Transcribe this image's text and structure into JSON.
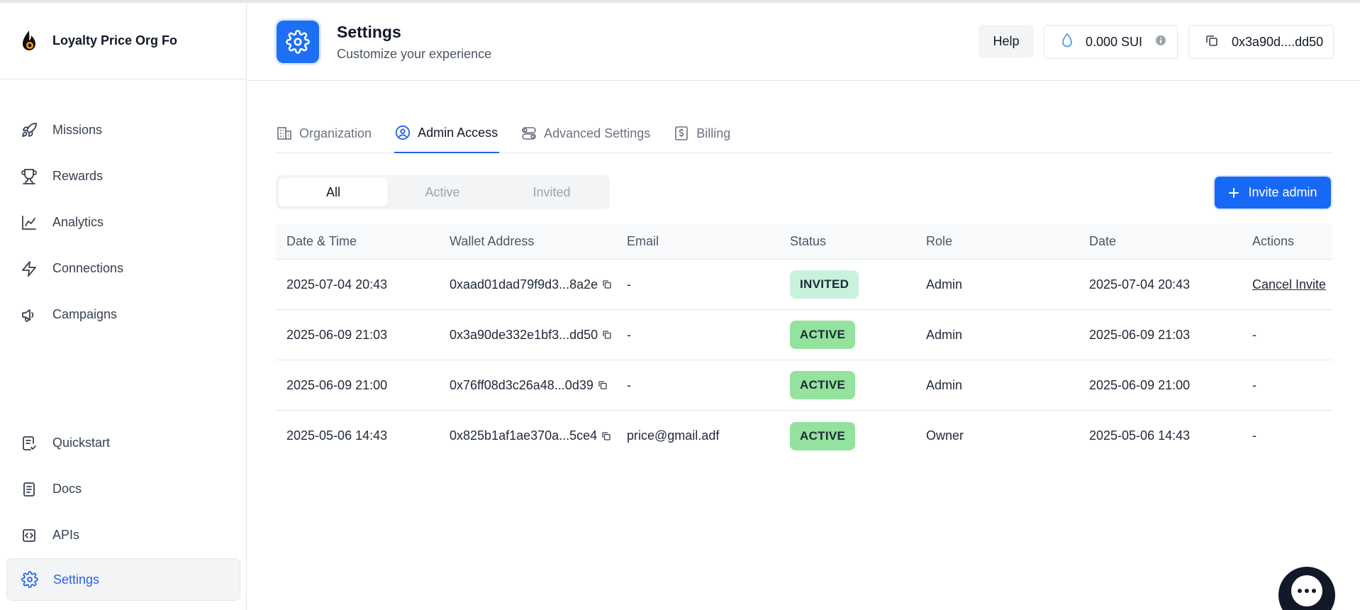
{
  "sidebar": {
    "brand_name": "Loyalty Price Org Fo",
    "nav_top": [
      {
        "label": "Missions",
        "icon": "rocket-icon"
      },
      {
        "label": "Rewards",
        "icon": "trophy-icon"
      },
      {
        "label": "Analytics",
        "icon": "chart-line-icon"
      },
      {
        "label": "Connections",
        "icon": "lightning-icon"
      },
      {
        "label": "Campaigns",
        "icon": "megaphone-icon"
      }
    ],
    "nav_bottom": [
      {
        "label": "Quickstart",
        "icon": "quickstart-icon"
      },
      {
        "label": "Docs",
        "icon": "document-icon"
      },
      {
        "label": "APIs",
        "icon": "code-icon"
      },
      {
        "label": "Settings",
        "icon": "gear-icon",
        "active": true
      }
    ]
  },
  "header": {
    "title": "Settings",
    "subtitle": "Customize your experience",
    "help_label": "Help",
    "balance": "0.000 SUI",
    "wallet": "0x3a90d....dd50"
  },
  "tabs": [
    {
      "label": "Organization",
      "icon": "building-icon"
    },
    {
      "label": "Admin Access",
      "icon": "user-circle-icon",
      "active": true
    },
    {
      "label": "Advanced Settings",
      "icon": "toggles-icon"
    },
    {
      "label": "Billing",
      "icon": "dollar-receipt-icon"
    }
  ],
  "filters": [
    "All",
    "Active",
    "Invited"
  ],
  "invite_label": "Invite admin",
  "table": {
    "headers": [
      "Date & Time",
      "Wallet Address",
      "Email",
      "Status",
      "Role",
      "Date",
      "Actions"
    ],
    "rows": [
      {
        "datetime": "2025-07-04 20:43",
        "wallet": "0xaad01dad79f9d3...8a2e",
        "email": "-",
        "status": "INVITED",
        "role": "Admin",
        "date": "2025-07-04 20:43",
        "action": "Cancel Invite"
      },
      {
        "datetime": "2025-06-09 21:03",
        "wallet": "0x3a90de332e1bf3...dd50",
        "email": "-",
        "status": "ACTIVE",
        "role": "Admin",
        "date": "2025-06-09 21:03",
        "action": "-"
      },
      {
        "datetime": "2025-06-09 21:00",
        "wallet": "0x76ff08d3c26a48...0d39",
        "email": "-",
        "status": "ACTIVE",
        "role": "Admin",
        "date": "2025-06-09 21:00",
        "action": "-"
      },
      {
        "datetime": "2025-05-06 14:43",
        "wallet": "0x825b1af1ae370a...5ce4",
        "email": "price@gmail.adf",
        "status": "ACTIVE",
        "role": "Owner",
        "date": "2025-05-06 14:43",
        "action": "-"
      }
    ]
  },
  "colors": {
    "accent": "#1769f5",
    "invited_badge": "#c9f2dc",
    "active_badge": "#93e29d"
  }
}
